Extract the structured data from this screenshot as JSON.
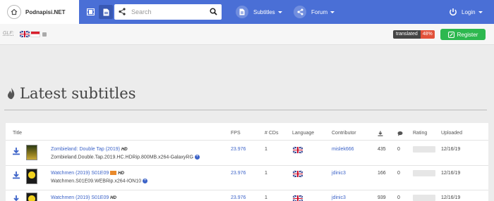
{
  "site": {
    "name": "Podnapisi.NET"
  },
  "search": {
    "placeholder": "Search"
  },
  "nav": {
    "subtitles": "Subtitles",
    "forum": "Forum",
    "login": "Login"
  },
  "subbar": {
    "glf": "GLF:",
    "translated_label": "translated",
    "translated_pct": "48%",
    "register": "Register"
  },
  "page": {
    "title": "Latest subtitles"
  },
  "table": {
    "headers": {
      "title": "Title",
      "fps": "FPS",
      "cds": "# CDs",
      "language": "Language",
      "contributor": "Contributor",
      "rating": "Rating",
      "uploaded": "Uploaded"
    },
    "rows": [
      {
        "title": "Zombieland: Double Tap (2019)",
        "hd": "HD",
        "release": "Zombieland.Double.Tap.2019.HC.HDRip.800MB.x264-GalaxyRG",
        "fps": "23.976",
        "cds": "1",
        "language": "English",
        "contributor": "mislek666",
        "downloads": "435",
        "comments": "0",
        "uploaded": "12/16/19"
      },
      {
        "title": "Watchmen (2019) S01E09",
        "hd": "HD",
        "release": "Watchmen.S01E09.WEBRip.x264-ION10",
        "fps": "23.976",
        "cds": "1",
        "language": "English",
        "contributor": "jdinic3",
        "downloads": "166",
        "comments": "0",
        "uploaded": "12/16/19"
      },
      {
        "title": "Watchmen (2019) S01E09",
        "hd": "HD",
        "release": "",
        "fps": "23.976",
        "cds": "1",
        "language": "English",
        "contributor": "jdinic3",
        "downloads": "939",
        "comments": "0",
        "uploaded": "12/16/19"
      }
    ]
  },
  "colors": {
    "topbar": "#4a6fd6",
    "accent_link": "#3c63c8",
    "register": "#2db84f",
    "translated_pct": "#e2513a"
  },
  "icons": [
    "home-icon",
    "film-icon",
    "document-icon",
    "share-icon",
    "search-icon",
    "power-icon",
    "pen-icon",
    "download-icon",
    "comment-icon"
  ]
}
